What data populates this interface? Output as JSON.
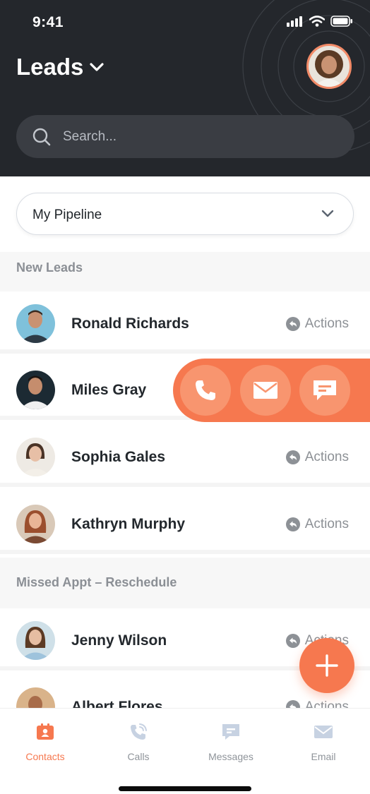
{
  "status_bar": {
    "time": "9:41"
  },
  "header": {
    "title": "Leads",
    "title_icon": "chevron-down-icon"
  },
  "search": {
    "placeholder": "Search...",
    "value": ""
  },
  "pipeline": {
    "selected": "My Pipeline"
  },
  "sections": [
    {
      "label": "New Leads",
      "leads": [
        {
          "name": "Ronald Richards",
          "action_label": "Actions",
          "skin": "#c99272",
          "bg": "#7fc1db",
          "shirt": "#2d3a45"
        },
        {
          "name": "Miles Gray",
          "action_label": "",
          "skin": "#c58d6d",
          "bg": "#1c2a33",
          "shirt": "#f0f0f0"
        },
        {
          "name": "Sophia Gales",
          "action_label": "Actions",
          "skin": "#e7bfa6",
          "bg": "#eeeae4",
          "shirt": "#f3efe8"
        },
        {
          "name": "Kathryn Murphy",
          "action_label": "Actions",
          "skin": "#e9b596",
          "bg": "#d9c9b8",
          "shirt": "#7a4a33"
        }
      ]
    },
    {
      "label": "Missed Appt – Reschedule",
      "leads": [
        {
          "name": "Jenny Wilson",
          "action_label": "Actions",
          "skin": "#e6bda2",
          "bg": "#cfe0e8",
          "shirt": "#9ec3dc"
        },
        {
          "name": "Albert Flores",
          "action_label": "Actions",
          "skin": "#a86c4a",
          "bg": "#d9b38a",
          "shirt": "#2b2b2b"
        }
      ]
    }
  ],
  "swipe_actions": [
    "phone-icon",
    "mail-icon",
    "message-icon"
  ],
  "fab": {
    "icon": "plus-icon"
  },
  "tabs": [
    {
      "label": "Contacts",
      "icon": "contacts-icon",
      "active": true
    },
    {
      "label": "Calls",
      "icon": "calls-icon",
      "active": false
    },
    {
      "label": "Messages",
      "icon": "messages-icon",
      "active": false
    },
    {
      "label": "Email",
      "icon": "email-icon",
      "active": false
    }
  ],
  "colors": {
    "accent": "#f6784f",
    "header_bg": "#24272c",
    "search_bg": "#3a3d43",
    "section_bg": "#f7f7f7",
    "muted_text": "#8b8f95"
  }
}
